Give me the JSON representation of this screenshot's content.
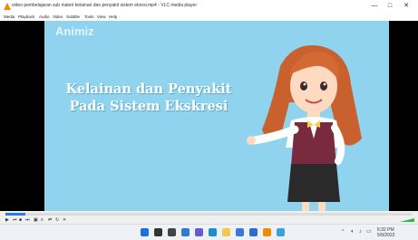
{
  "window": {
    "title": "video pembelajaran sub materi kelainan dan penyakit sistem ekresi.mp4 - VLC media player",
    "minimize": "—",
    "maximize": "□",
    "close": "✕"
  },
  "menu": {
    "items": [
      "Media",
      "Playback",
      "Audio",
      "Video",
      "Subtitle",
      "Tools",
      "View",
      "Help"
    ]
  },
  "video": {
    "brand": "Animiz",
    "headline_line1": "Kelainan dan Penyakit",
    "headline_line2": "Pada Sistem Ekskresi"
  },
  "player": {
    "progress_fraction": 0.05,
    "buttons": [
      "▶",
      "⏮",
      "■",
      "⏭",
      "▣",
      "≡",
      "⇄",
      "↻",
      "✕"
    ]
  },
  "taskbar": {
    "icons": [
      "windows-start-icon",
      "search-icon",
      "task-view-icon",
      "widgets-icon",
      "chat-icon",
      "edge-browser-icon",
      "file-explorer-icon",
      "store-icon",
      "mail-icon",
      "vlc-icon",
      "app-icon"
    ],
    "icon_colors": [
      "#1e6fd9",
      "#333333",
      "#444444",
      "#2f7ad8",
      "#6a5acd",
      "#1a8fd6",
      "#f2c84b",
      "#3a7bd5",
      "#2b6fce",
      "#f08a00",
      "#3aa0e0"
    ],
    "tray": {
      "chevron": "^",
      "time": "6:32 PM",
      "date": "5/9/2022"
    }
  }
}
